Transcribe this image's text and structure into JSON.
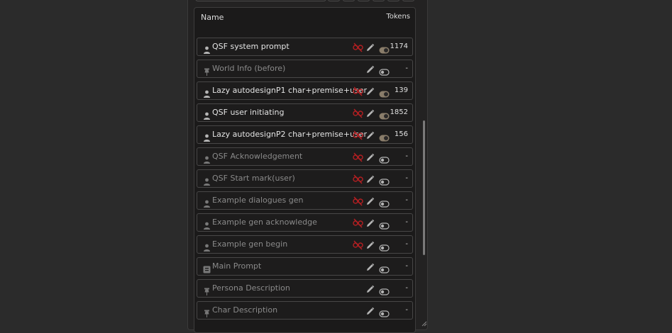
{
  "header": {
    "name_label": "Name",
    "tokens_label": "Tokens"
  },
  "prompts": [
    {
      "name": "QSF system prompt",
      "icon": "user-icon",
      "enabled": true,
      "link": true,
      "tokens": "1174"
    },
    {
      "name": "World Info (before)",
      "icon": "pin-icon",
      "enabled": false,
      "link": false,
      "tokens": "-"
    },
    {
      "name": "Lazy autodesignP1 char+premise+user",
      "icon": "user-icon",
      "enabled": true,
      "link": true,
      "tokens": "139"
    },
    {
      "name": "QSF user initiating",
      "icon": "user-icon",
      "enabled": true,
      "link": true,
      "tokens": "1852"
    },
    {
      "name": "Lazy autodesignP2 char+premise+user",
      "icon": "user-icon",
      "enabled": true,
      "link": true,
      "tokens": "156"
    },
    {
      "name": "QSF Acknowledgement",
      "icon": "user-icon",
      "enabled": false,
      "link": true,
      "tokens": "-"
    },
    {
      "name": "QSF Start mark(user)",
      "icon": "user-icon",
      "enabled": false,
      "link": true,
      "tokens": "-"
    },
    {
      "name": "Example dialogues gen",
      "icon": "user-icon",
      "enabled": false,
      "link": true,
      "tokens": "-"
    },
    {
      "name": "Example gen acknowledge",
      "icon": "user-icon",
      "enabled": false,
      "link": true,
      "tokens": "-"
    },
    {
      "name": "Example gen begin",
      "icon": "user-icon",
      "enabled": false,
      "link": true,
      "tokens": "-"
    },
    {
      "name": "Main Prompt",
      "icon": "square-icon",
      "enabled": false,
      "link": false,
      "tokens": "-"
    },
    {
      "name": "Persona Description",
      "icon": "pin-icon",
      "enabled": false,
      "link": false,
      "tokens": "-"
    },
    {
      "name": "Char Description",
      "icon": "pin-icon",
      "enabled": false,
      "link": false,
      "tokens": "-"
    }
  ],
  "colors": {
    "link_broken": "#b51f22",
    "icon_gray": "#b5b5b5",
    "toggle_on": "#8a7d6a"
  }
}
